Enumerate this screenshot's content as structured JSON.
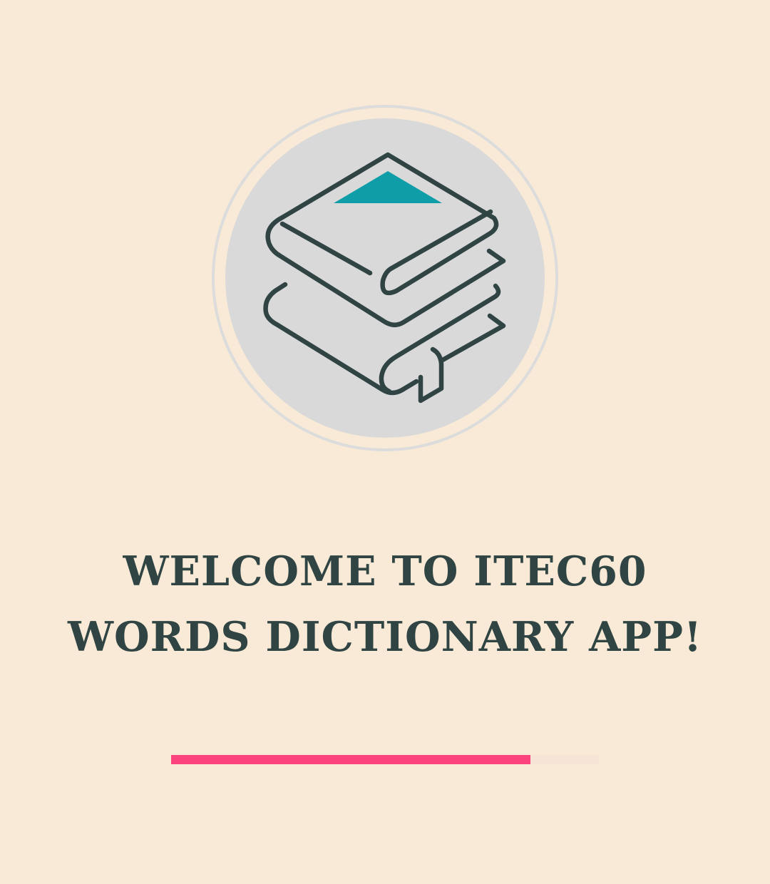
{
  "app": {
    "welcome_text": "WELCOME TO ITEC60 WORDS DICTIONARY APP!"
  },
  "logo": {
    "icon": "stacked-books-icon"
  },
  "progress": {
    "value": 0.84
  },
  "colors": {
    "background": "#f8ead6",
    "logo_circle": "#d9d9d9",
    "icon_stroke": "#2f4443",
    "accent_teal": "#0f9ea8",
    "title_text": "#2f4443",
    "progress_fill": "#fb437c",
    "progress_track": "#f6e4d6"
  }
}
